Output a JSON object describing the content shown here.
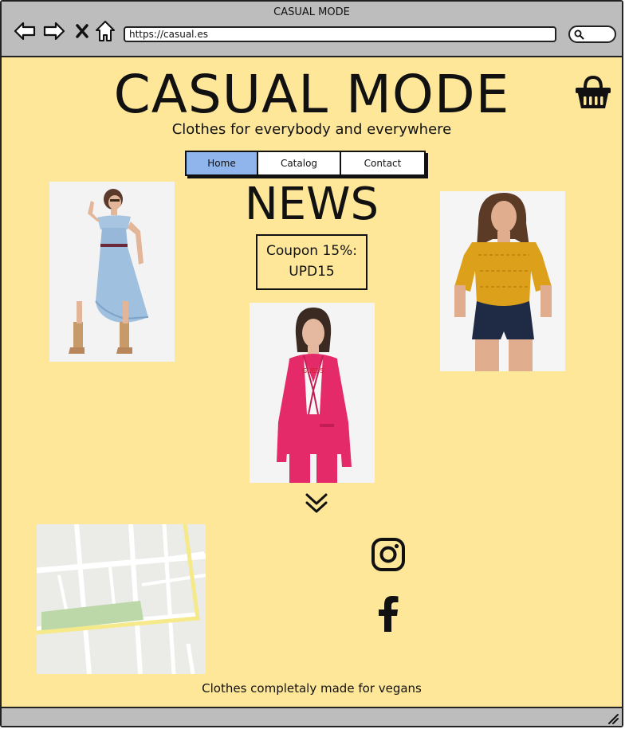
{
  "window": {
    "title": "CASUAL MODE",
    "url": "https://casual.es"
  },
  "header": {
    "title": "CASUAL MODE",
    "tagline": "Clothes for everybody and everywhere"
  },
  "nav": {
    "tabs": [
      {
        "label": "Home",
        "active": true
      },
      {
        "label": "Catalog",
        "active": false
      },
      {
        "label": "Contact",
        "active": false
      }
    ]
  },
  "main": {
    "news_heading": "NEWS",
    "coupon_line1": "Coupon 15%:",
    "coupon_line2": "UPD15"
  },
  "footer": {
    "text": "Clothes completaly made for vegans"
  },
  "colors": {
    "page_bg": "#fee799",
    "chrome": "#bdbdbd",
    "active_tab": "#90b4ec",
    "map_park": "#bcd8a8",
    "map_road_yellow": "#f5e98a"
  },
  "icons": [
    "back-arrow-icon",
    "forward-arrow-icon",
    "close-icon",
    "home-icon",
    "search-icon",
    "shopping-basket-icon",
    "chevron-double-down-icon",
    "instagram-icon",
    "facebook-icon",
    "resize-handle-icon"
  ]
}
